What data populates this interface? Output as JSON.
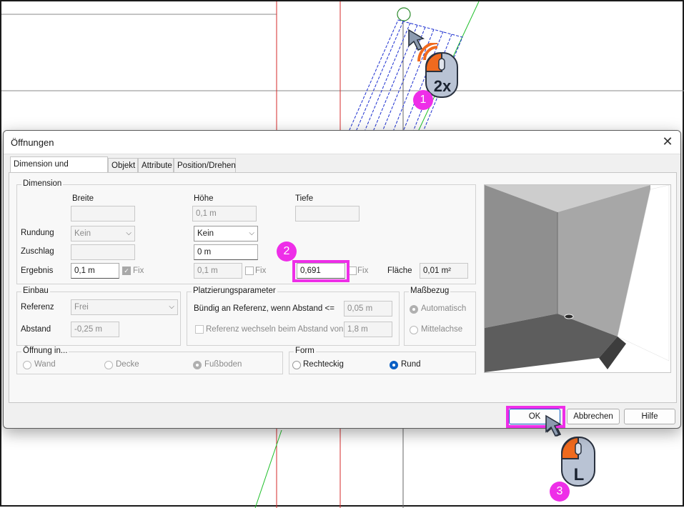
{
  "dialog": {
    "title": "Öffnungen",
    "close_symbol": "✕",
    "tabs": [
      {
        "label": "Dimension und Platzierung"
      },
      {
        "label": "Objekt"
      },
      {
        "label": "Attribute"
      },
      {
        "label": "Position/Drehen"
      }
    ]
  },
  "dimension": {
    "legend": "Dimension",
    "col_breite": "Breite",
    "col_hoehe": "Höhe",
    "col_tiefe": "Tiefe",
    "hoehe_value": "0,1 m",
    "rundung_label": "Rundung",
    "rundung_breite": "Kein",
    "rundung_hoehe": "Kein",
    "zuschlag_label": "Zuschlag",
    "zuschlag_hoehe": "0 m",
    "ergebnis_label": "Ergebnis",
    "ergebnis_breite": "0,1 m",
    "ergebnis_hoehe": "0,1 m",
    "ergebnis_tiefe": "0,691",
    "fix_label": "Fix",
    "flaeche_label": "Fläche",
    "flaeche_value": "0,01 m²"
  },
  "einbau": {
    "legend": "Einbau",
    "referenz_label": "Referenz",
    "referenz_value": "Frei",
    "abstand_label": "Abstand",
    "abstand_value": "-0,25 m"
  },
  "platzierung": {
    "legend": "Platzierungsparameter",
    "buendig_label": "Bündig an Referenz, wenn Abstand <=",
    "buendig_value": "0,05 m",
    "wechseln_label": "Referenz wechseln beim Abstand von",
    "wechseln_value": "1,8 m"
  },
  "massbezug": {
    "legend": "Maßbezug",
    "automatisch": "Automatisch",
    "mittelachse": "Mittelachse"
  },
  "oeffnung_in": {
    "legend": "Öffnung in...",
    "wand": "Wand",
    "decke": "Decke",
    "fussboden": "Fußboden"
  },
  "form": {
    "legend": "Form",
    "rechteckig": "Rechteckig",
    "rund": "Rund"
  },
  "buttons": {
    "ok": "OK",
    "abbrechen": "Abbrechen",
    "hilfe": "Hilfe"
  },
  "annotations": {
    "step1": "1",
    "step2": "2",
    "step3": "3",
    "double_click": "2x",
    "left_click": "L"
  },
  "colors": {
    "highlight": "#ee2ee8",
    "mouse_orange": "#f06a1e",
    "red_line": "#d42a2a",
    "green_line": "#1fbf2a",
    "hatch_blue": "#1c2fd0"
  }
}
